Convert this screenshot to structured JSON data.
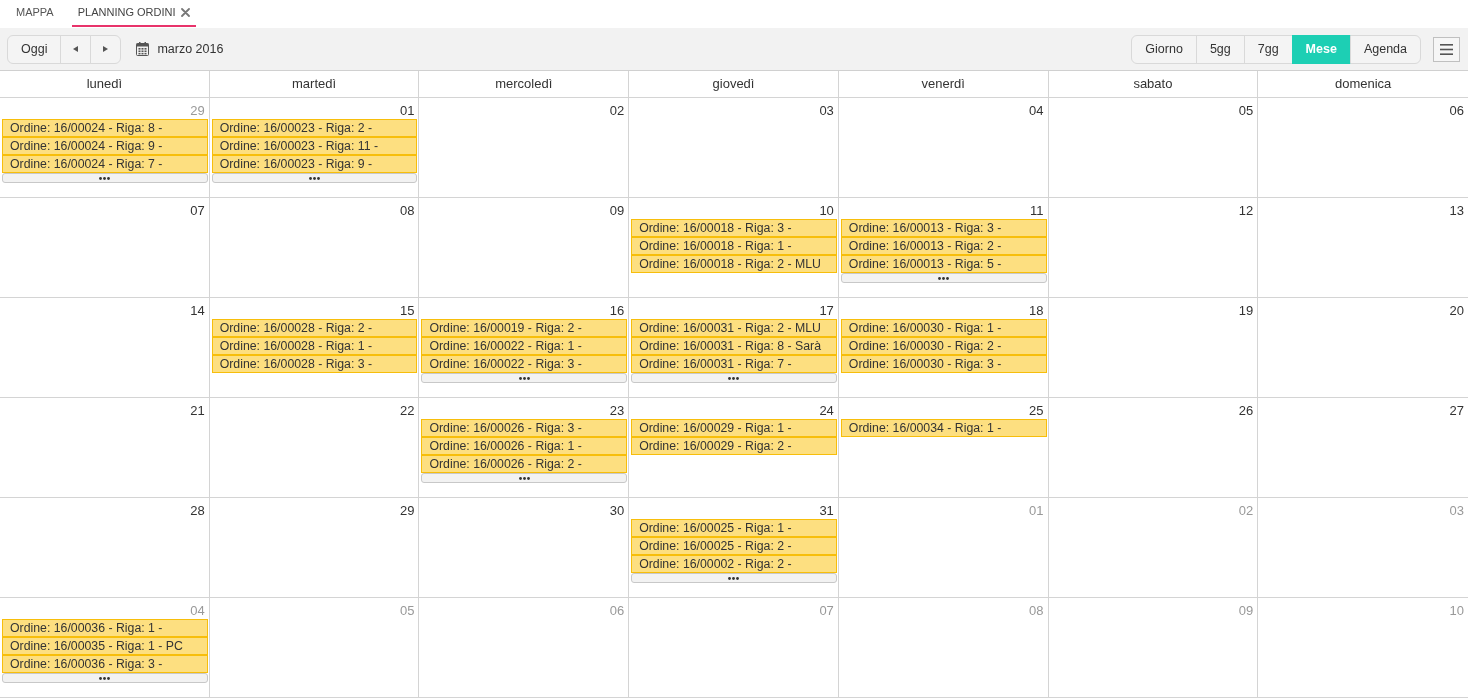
{
  "tabs": [
    {
      "label": "MAPPA",
      "selected": false,
      "closable": false
    },
    {
      "label": "PLANNING ORDINI",
      "selected": true,
      "closable": true
    }
  ],
  "toolbar": {
    "today_label": "Oggi",
    "period_label": "marzo 2016",
    "views": [
      {
        "label": "Giorno",
        "selected": false
      },
      {
        "label": "5gg",
        "selected": false
      },
      {
        "label": "7gg",
        "selected": false
      },
      {
        "label": "Mese",
        "selected": true
      },
      {
        "label": "Agenda",
        "selected": false
      }
    ]
  },
  "calendar": {
    "weekdays": [
      "lunedì",
      "martedì",
      "mercoledì",
      "giovedì",
      "venerdì",
      "sabato",
      "domenica"
    ],
    "weeks": [
      {
        "days": [
          {
            "day": "29",
            "in_month": false,
            "events": [
              "Ordine: 16/00024 - Riga: 8 -",
              "Ordine: 16/00024 - Riga: 9 -",
              "Ordine: 16/00024 - Riga: 7 -"
            ],
            "has_more": true
          },
          {
            "day": "01",
            "in_month": true,
            "events": [
              "Ordine: 16/00023 - Riga: 2 -",
              "Ordine: 16/00023 - Riga: 11 -",
              "Ordine: 16/00023 - Riga: 9 -"
            ],
            "has_more": true
          },
          {
            "day": "02",
            "in_month": true
          },
          {
            "day": "03",
            "in_month": true
          },
          {
            "day": "04",
            "in_month": true
          },
          {
            "day": "05",
            "in_month": true
          },
          {
            "day": "06",
            "in_month": true
          }
        ]
      },
      {
        "days": [
          {
            "day": "07",
            "in_month": true
          },
          {
            "day": "08",
            "in_month": true
          },
          {
            "day": "09",
            "in_month": true
          },
          {
            "day": "10",
            "in_month": true,
            "events": [
              "Ordine: 16/00018 - Riga: 3 -",
              "Ordine: 16/00018 - Riga: 1 -",
              "Ordine: 16/00018 - Riga: 2 - MLU"
            ],
            "has_more": false
          },
          {
            "day": "11",
            "in_month": true,
            "events": [
              "Ordine: 16/00013 - Riga: 3 -",
              "Ordine: 16/00013 - Riga: 2 -",
              "Ordine: 16/00013 - Riga: 5 -"
            ],
            "has_more": true
          },
          {
            "day": "12",
            "in_month": true
          },
          {
            "day": "13",
            "in_month": true
          }
        ]
      },
      {
        "days": [
          {
            "day": "14",
            "in_month": true
          },
          {
            "day": "15",
            "in_month": true,
            "events": [
              "Ordine: 16/00028 - Riga: 2 -",
              "Ordine: 16/00028 - Riga: 1 -",
              "Ordine: 16/00028 - Riga: 3 -"
            ],
            "has_more": false
          },
          {
            "day": "16",
            "in_month": true,
            "events": [
              "Ordine: 16/00019 - Riga: 2 -",
              "Ordine: 16/00022 - Riga: 1 -",
              "Ordine: 16/00022 - Riga: 3 -"
            ],
            "has_more": true
          },
          {
            "day": "17",
            "in_month": true,
            "events": [
              "Ordine: 16/00031 - Riga: 2 - MLU",
              "Ordine: 16/00031 - Riga: 8 - Sarà",
              "Ordine: 16/00031 - Riga: 7 -"
            ],
            "has_more": true
          },
          {
            "day": "18",
            "in_month": true,
            "events": [
              "Ordine: 16/00030 - Riga: 1 -",
              "Ordine: 16/00030 - Riga: 2 -",
              "Ordine: 16/00030 - Riga: 3 -"
            ],
            "has_more": false
          },
          {
            "day": "19",
            "in_month": true
          },
          {
            "day": "20",
            "in_month": true
          }
        ]
      },
      {
        "days": [
          {
            "day": "21",
            "in_month": true
          },
          {
            "day": "22",
            "in_month": true
          },
          {
            "day": "23",
            "in_month": true,
            "events": [
              "Ordine: 16/00026 - Riga: 3 -",
              "Ordine: 16/00026 - Riga: 1 -",
              "Ordine: 16/00026 - Riga: 2 -"
            ],
            "has_more": true
          },
          {
            "day": "24",
            "in_month": true,
            "events": [
              "Ordine: 16/00029 - Riga: 1 -",
              "Ordine: 16/00029 - Riga: 2 -"
            ],
            "has_more": false
          },
          {
            "day": "25",
            "in_month": true,
            "events": [
              "Ordine: 16/00034 - Riga: 1 -"
            ],
            "has_more": false
          },
          {
            "day": "26",
            "in_month": true
          },
          {
            "day": "27",
            "in_month": true
          }
        ]
      },
      {
        "days": [
          {
            "day": "28",
            "in_month": true
          },
          {
            "day": "29",
            "in_month": true
          },
          {
            "day": "30",
            "in_month": true
          },
          {
            "day": "31",
            "in_month": true,
            "events": [
              "Ordine: 16/00025 - Riga: 1 -",
              "Ordine: 16/00025 - Riga: 2 -",
              "Ordine: 16/00002 - Riga: 2 -"
            ],
            "has_more": true
          },
          {
            "day": "01",
            "in_month": false
          },
          {
            "day": "02",
            "in_month": false
          },
          {
            "day": "03",
            "in_month": false
          }
        ]
      },
      {
        "days": [
          {
            "day": "04",
            "in_month": false,
            "events": [
              "Ordine: 16/00036 - Riga: 1 -",
              "Ordine: 16/00035 - Riga: 1 - PC",
              "Ordine: 16/00036 - Riga: 3 -"
            ],
            "has_more": true
          },
          {
            "day": "05",
            "in_month": false
          },
          {
            "day": "06",
            "in_month": false
          },
          {
            "day": "07",
            "in_month": false
          },
          {
            "day": "08",
            "in_month": false
          },
          {
            "day": "09",
            "in_month": false
          },
          {
            "day": "10",
            "in_month": false
          }
        ]
      }
    ]
  }
}
